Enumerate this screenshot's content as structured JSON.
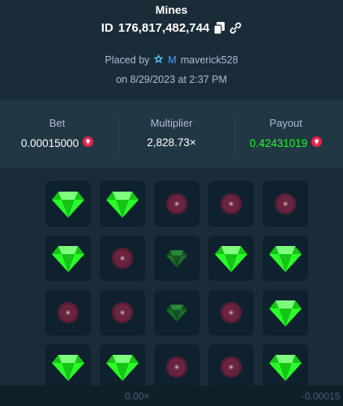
{
  "header": {
    "title": "Mines",
    "id_label": "ID",
    "id_value": "176,817,482,744",
    "placed_by": "Placed by",
    "vip_badge": "M",
    "username": "maverick528",
    "date": "on 8/29/2023 at 2:37 PM"
  },
  "stats": {
    "bet_label": "Bet",
    "bet_value": "0.00015000",
    "multiplier_label": "Multiplier",
    "multiplier_value": "2,828.73×",
    "payout_label": "Payout",
    "payout_value": "0.42431019",
    "payout_color": "#1fff20"
  },
  "board": {
    "rows": [
      [
        "gem",
        "gem",
        "mine",
        "mine",
        "mine"
      ],
      [
        "gem",
        "mine",
        "gem-dim",
        "gem",
        "gem"
      ],
      [
        "mine",
        "mine",
        "gem-dim",
        "mine",
        "gem"
      ],
      [
        "gem",
        "gem",
        "mine",
        "mine",
        "gem"
      ]
    ]
  },
  "footer": {
    "multiplier": "0.00×",
    "profit": "-0.00015"
  },
  "icons": {
    "copy": "copy-icon",
    "link": "link-icon",
    "star": "star-icon",
    "currency": "ruby-currency-icon",
    "gem": "gem-icon",
    "mine": "mine-icon"
  }
}
